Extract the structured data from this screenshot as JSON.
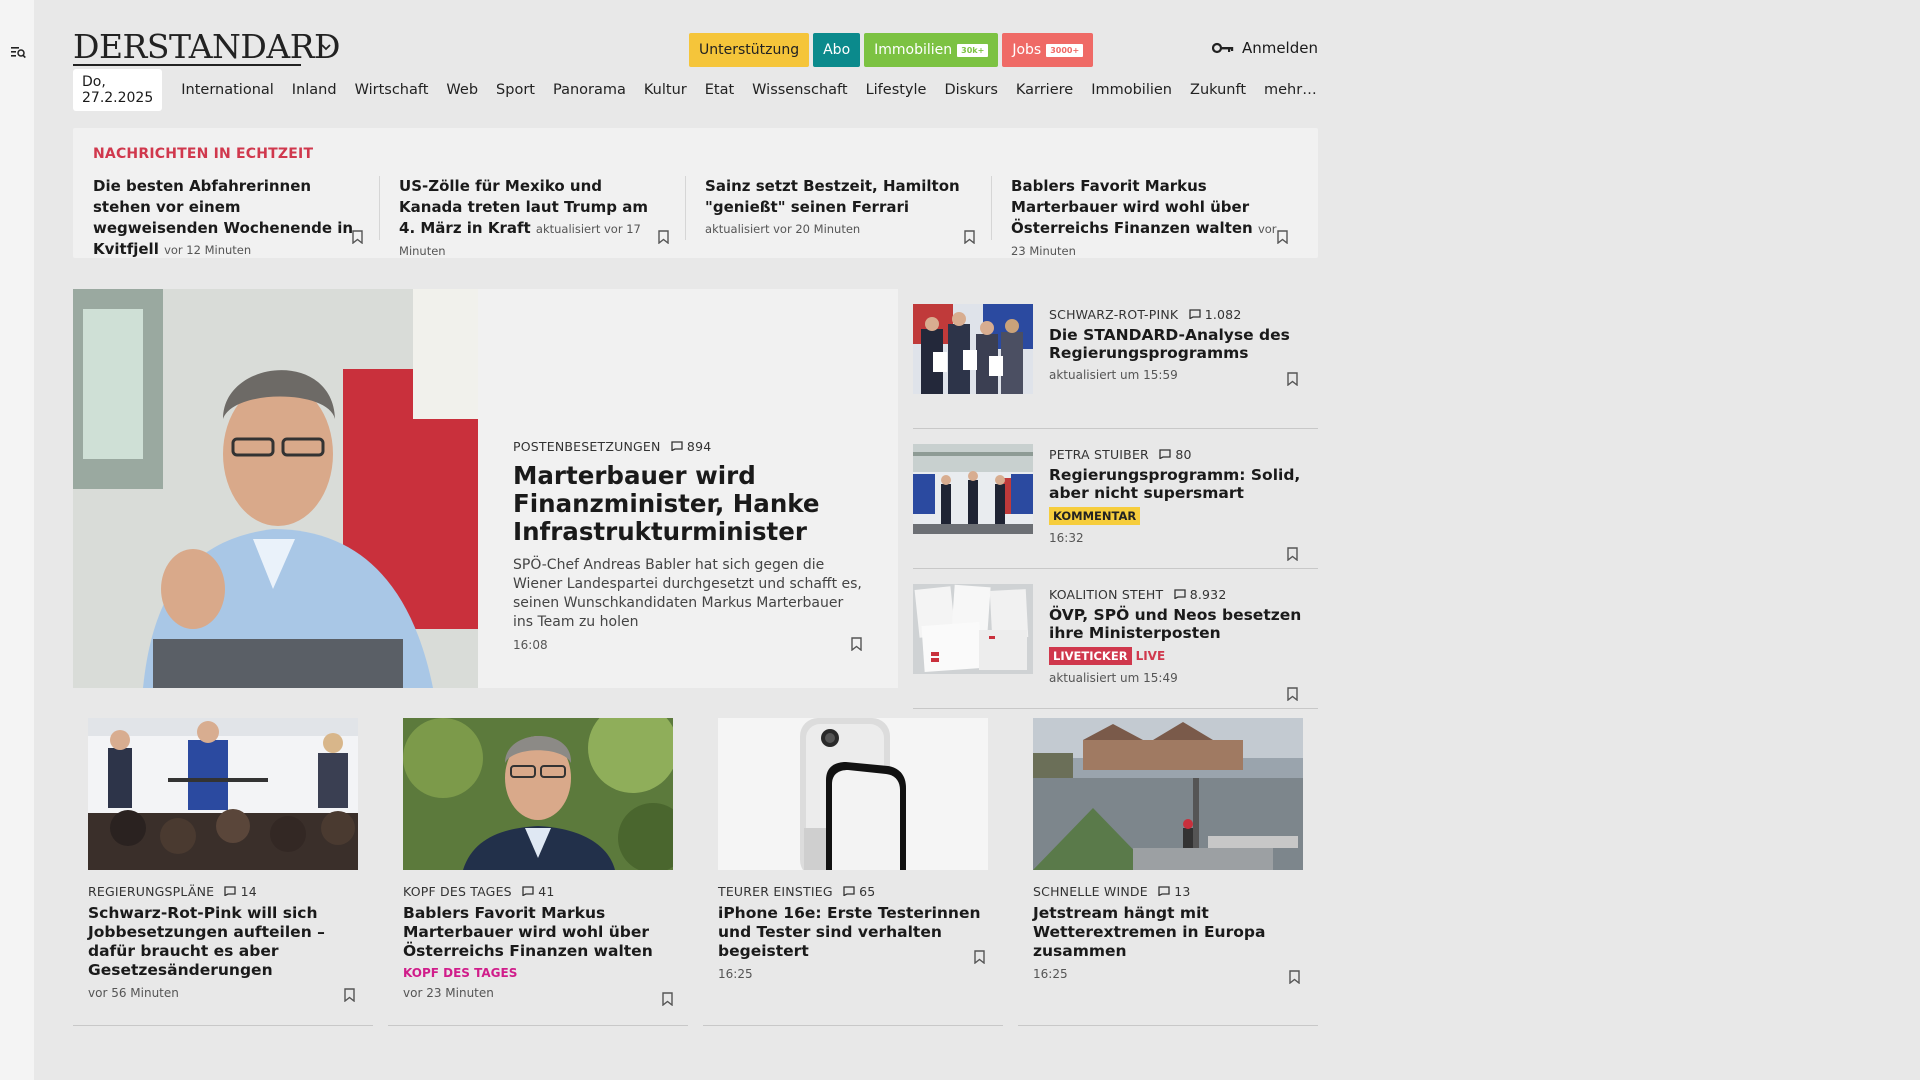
{
  "brand": {
    "logo": "DERSTANDARD",
    "colors": {
      "accent_red": "#d0384d",
      "kommentar_yellow": "#f6cd3c",
      "kopf_pink": "#d01d8a"
    }
  },
  "header": {
    "chips": [
      {
        "label": "Unterstützung",
        "bg": "#f5c53a",
        "fg": "#222"
      },
      {
        "label": "Abo",
        "bg": "#0b8a8c",
        "fg": "#fff"
      },
      {
        "label": "Immobilien",
        "tag": "30k+",
        "bg": "#7cc242",
        "fg": "#fff"
      },
      {
        "label": "Jobs",
        "tag": "3000+",
        "bg": "#ef6a66",
        "fg": "#fff"
      }
    ],
    "login_label": "Anmelden"
  },
  "nav": {
    "date": "Do, 27.2.2025",
    "items": [
      "International",
      "Inland",
      "Wirtschaft",
      "Web",
      "Sport",
      "Panorama",
      "Kultur",
      "Etat",
      "Wissenschaft",
      "Lifestyle",
      "Diskurs",
      "Karriere",
      "Immobilien",
      "Zukunft",
      "mehr…"
    ]
  },
  "ticker": {
    "title": "NACHRICHTEN IN ECHTZEIT",
    "items": [
      {
        "title": "Die besten Abfahrerinnen stehen vor einem wegweisenden Wochenende in Kvitfjell",
        "meta": "vor 12 Minuten"
      },
      {
        "title": "US-Zölle für Mexiko und Kanada treten laut Trump am 4. März in Kraft",
        "meta": "aktualisiert vor 17 Minuten"
      },
      {
        "title": "Sainz setzt Bestzeit, Hamilton \"genießt\" seinen Ferrari",
        "meta": "aktualisiert vor 20 Minuten"
      },
      {
        "title": "Bablers Favorit Markus Marterbauer wird wohl über Österreichs Finanzen walten",
        "meta": "vor 23 Minuten"
      }
    ]
  },
  "hero": {
    "kicker": "POSTENBESETZUNGEN",
    "comments": "894",
    "title": "Marterbauer wird Finanzminister, Hanke Infrastrukturminister",
    "teaser": "SPÖ-Chef Andreas Babler hat sich gegen die Wiener Landespartei durchgesetzt und schafft es, seinen Wunschkandidaten Markus Marterbauer ins Team zu holen",
    "time": "16:08"
  },
  "side": [
    {
      "kicker": "SCHWARZ-ROT-PINK",
      "comments": "1.082",
      "title": "Die STANDARD-Analyse des Regierungsprogramms",
      "badge": "",
      "live": "",
      "time": "aktualisiert um 15:59"
    },
    {
      "kicker": "PETRA STUIBER",
      "comments": "80",
      "title": "Regierungsprogramm: Solid, aber nicht supersmart",
      "badge": "KOMMENTAR",
      "live": "",
      "time": "16:32"
    },
    {
      "kicker": "KOALITION STEHT",
      "comments": "8.932",
      "title": "ÖVP, SPÖ und Neos besetzen ihre Ministerposten",
      "badge": "LIVETICKER",
      "live": "LIVE",
      "time": "aktualisiert um 15:49"
    }
  ],
  "cards": [
    {
      "kicker": "REGIERUNGSPLÄNE",
      "comments": "14",
      "title": "Schwarz-Rot-Pink will sich Jobbesetzungen aufteilen – dafür braucht es aber Gesetzesänderungen",
      "badge": "",
      "time": "vor 56 Minuten"
    },
    {
      "kicker": "KOPF DES TAGES",
      "comments": "41",
      "title": "Bablers Favorit Markus Marterbauer wird wohl über Österreichs Finanzen walten",
      "badge": "KOPF DES TAGES",
      "time": "vor 23 Minuten"
    },
    {
      "kicker": "TEURER EINSTIEG",
      "comments": "65",
      "title": "iPhone 16e: Erste Testerinnen und Tester sind verhalten begeistert",
      "badge": "",
      "time": "16:25"
    },
    {
      "kicker": "SCHNELLE WINDE",
      "comments": "13",
      "title": "Jetstream hängt mit Wetterextremen in Europa zusammen",
      "badge": "",
      "time": "16:25"
    }
  ]
}
